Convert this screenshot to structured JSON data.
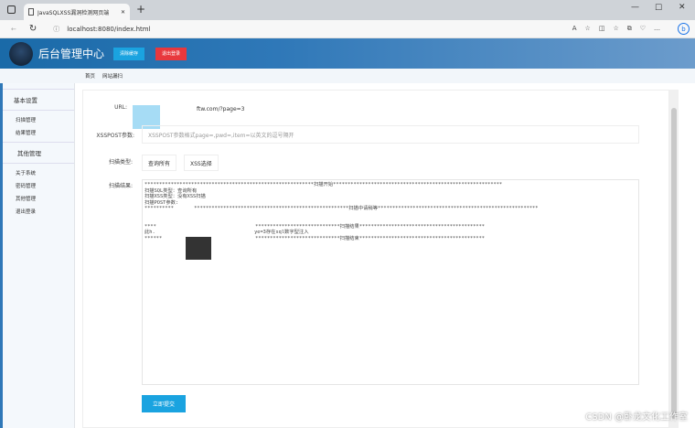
{
  "browser": {
    "tab_title": "JavaSQLXSS漏洞检测网页端",
    "url": "localhost:8080/index.html"
  },
  "header": {
    "title": "后台管理中心",
    "clear_cache": "清除缓存",
    "logout": "退出登录",
    "clear_color": "#1aa3e0",
    "logout_color": "#e8383d"
  },
  "breadcrumb": [
    "首页",
    "网站漏扫"
  ],
  "sidebar": {
    "groups": [
      {
        "title": "基本设置",
        "items": [
          "扫描管理",
          "结果管理"
        ]
      },
      {
        "title": "其他管理",
        "items": [
          "关于系统",
          "密码管理",
          "其他管理",
          "退出登录"
        ]
      }
    ]
  },
  "form": {
    "url_label": "URL:",
    "url_value": "ftw.com/?page=3",
    "post_label": "XSSPOST参数:",
    "post_placeholder": "XSSPOST参数格式page=,pwd=,item=以英文的逗号隔开",
    "type_label": "扫描类型:",
    "type_options": [
      "查询所有",
      "XSS选择"
    ],
    "result_label": "扫描结果:",
    "result_text": "**********************************************************扫描开始**********************************************************\n扫描SQL类型：查询所有\n扫描XSS类型：没有XSS扫描\n扫描POST参数:\n**********       *****************************************************扫描中请稍等*******************************************************\n\n\n****                                  *****************************扫描结果*******************************************\n此h.                                  ye=3存在sql数字型注入\n******                                *****************************扫描结束*******************************************",
    "submit": "立即提交"
  },
  "watermark": "CSDN @卧龙文化工作室"
}
